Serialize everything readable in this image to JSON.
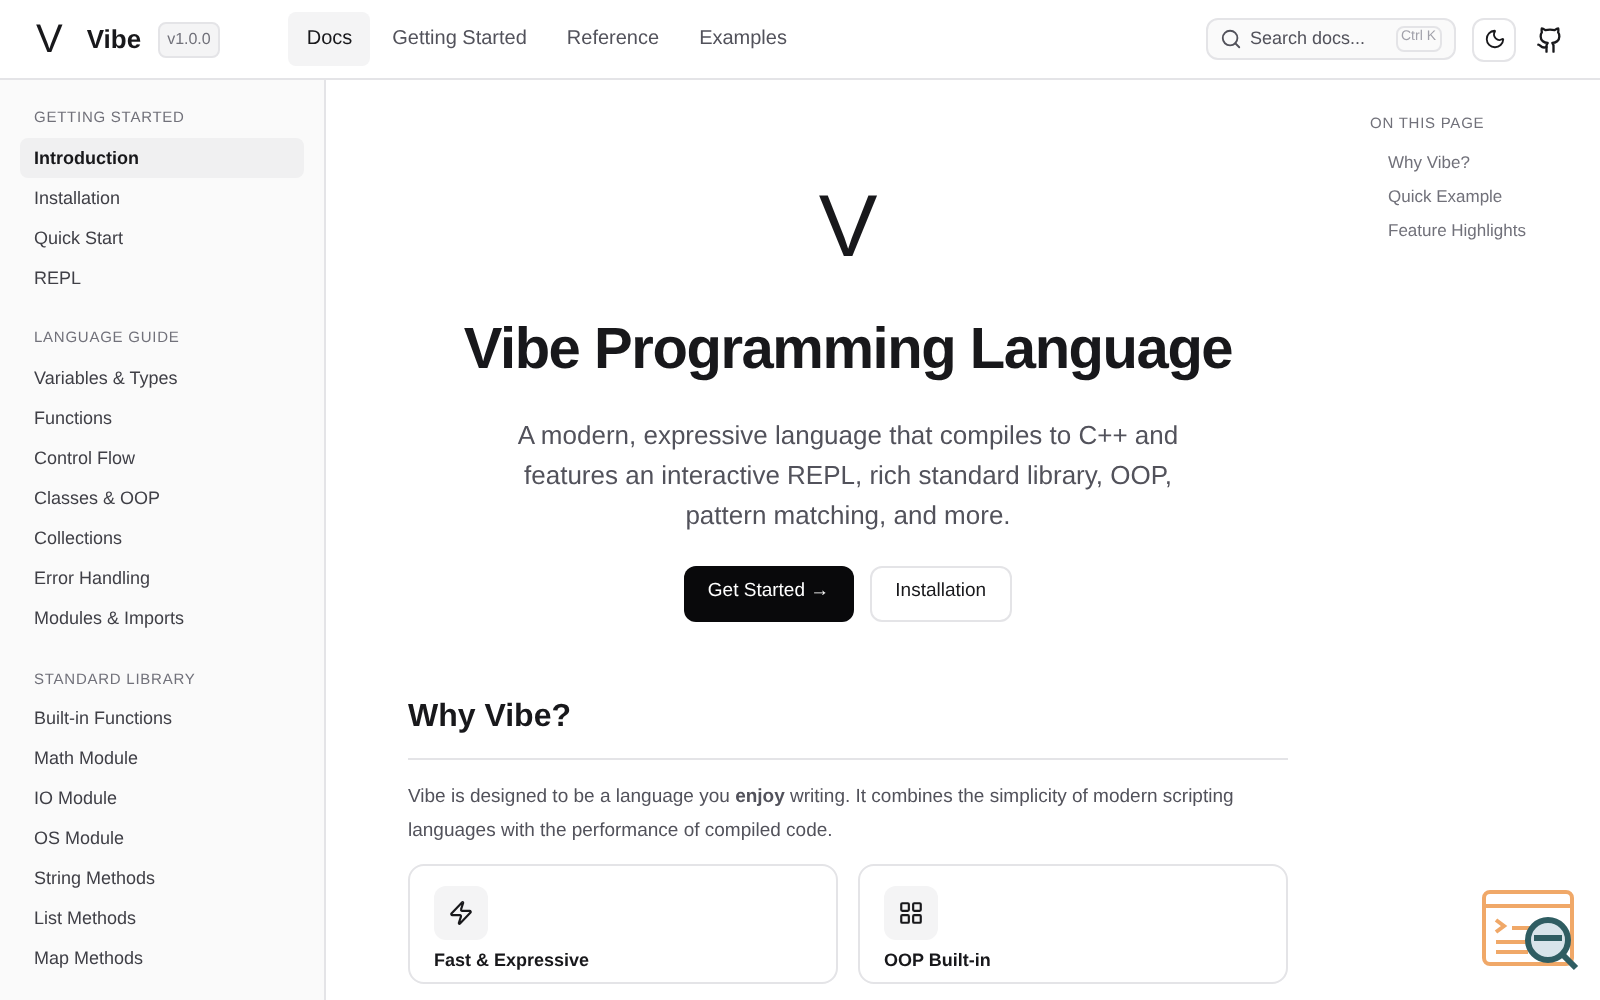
{
  "header": {
    "logo": "V",
    "name": "Vibe",
    "version": "v1.0.0",
    "nav": [
      {
        "label": "Docs",
        "selected": true
      },
      {
        "label": "Getting Started",
        "selected": false
      },
      {
        "label": "Reference",
        "selected": false
      },
      {
        "label": "Examples",
        "selected": false
      }
    ],
    "search": {
      "placeholder": "Search docs...",
      "shortcut": "Ctrl K"
    }
  },
  "sidebar": {
    "sections": [
      {
        "title": "GETTING STARTED",
        "items": [
          {
            "label": "Introduction",
            "selected": true
          },
          {
            "label": "Installation",
            "selected": false
          },
          {
            "label": "Quick Start",
            "selected": false
          },
          {
            "label": "REPL",
            "selected": false
          }
        ]
      },
      {
        "title": "LANGUAGE GUIDE",
        "items": [
          {
            "label": "Variables & Types",
            "selected": false
          },
          {
            "label": "Functions",
            "selected": false
          },
          {
            "label": "Control Flow",
            "selected": false
          },
          {
            "label": "Classes & OOP",
            "selected": false
          },
          {
            "label": "Collections",
            "selected": false
          },
          {
            "label": "Error Handling",
            "selected": false
          },
          {
            "label": "Modules & Imports",
            "selected": false
          }
        ]
      },
      {
        "title": "STANDARD LIBRARY",
        "items": [
          {
            "label": "Built-in Functions",
            "selected": false
          },
          {
            "label": "Math Module",
            "selected": false
          },
          {
            "label": "IO Module",
            "selected": false
          },
          {
            "label": "OS Module",
            "selected": false
          },
          {
            "label": "String Methods",
            "selected": false
          },
          {
            "label": "List Methods",
            "selected": false
          },
          {
            "label": "Map Methods",
            "selected": false
          }
        ]
      }
    ]
  },
  "hero": {
    "logo": "V",
    "title": "Vibe Programming Language",
    "subtitle": "A modern, expressive language that compiles to C++ and features an interactive REPL, rich standard library, OOP, pattern matching, and more.",
    "buttons": [
      {
        "label": "Get Started →",
        "kind": "primary"
      },
      {
        "label": "Installation",
        "kind": "secondary"
      }
    ]
  },
  "why": {
    "heading": "Why Vibe?",
    "text": "Vibe is designed to be a language you **enjoy** writing. It combines the simplicity of modern scripting languages with the performance of compiled code.",
    "cards": [
      {
        "kind": "bolt",
        "title": "Fast & Expressive"
      },
      {
        "kind": "grid",
        "title": "OOP Built-in"
      }
    ]
  },
  "toc": {
    "title": "ON THIS PAGE",
    "items": [
      "Why Vibe?",
      "Quick Example",
      "Feature Highlights"
    ]
  }
}
